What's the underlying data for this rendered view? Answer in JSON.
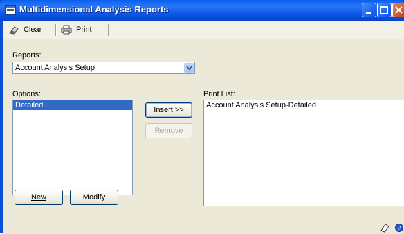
{
  "window": {
    "title": "Multidimensional Analysis Reports",
    "icon": "report-window-icon"
  },
  "toolbar": {
    "clear_label": "Clear",
    "print_label": "Print"
  },
  "reports": {
    "label": "Reports:",
    "selected": "Account Analysis Setup"
  },
  "options": {
    "label": "Options:",
    "items": [
      {
        "label": "Detailed",
        "selected": true
      }
    ]
  },
  "buttons": {
    "insert": "Insert >>",
    "remove": "Remove",
    "new": "New",
    "modify": "Modify"
  },
  "print_list": {
    "label": "Print List:",
    "items": [
      "Account Analysis Setup-Detailed"
    ]
  },
  "colors": {
    "titlebar": "#0a55e6",
    "selection": "#316ac5",
    "client_bg": "#ece9d8"
  }
}
